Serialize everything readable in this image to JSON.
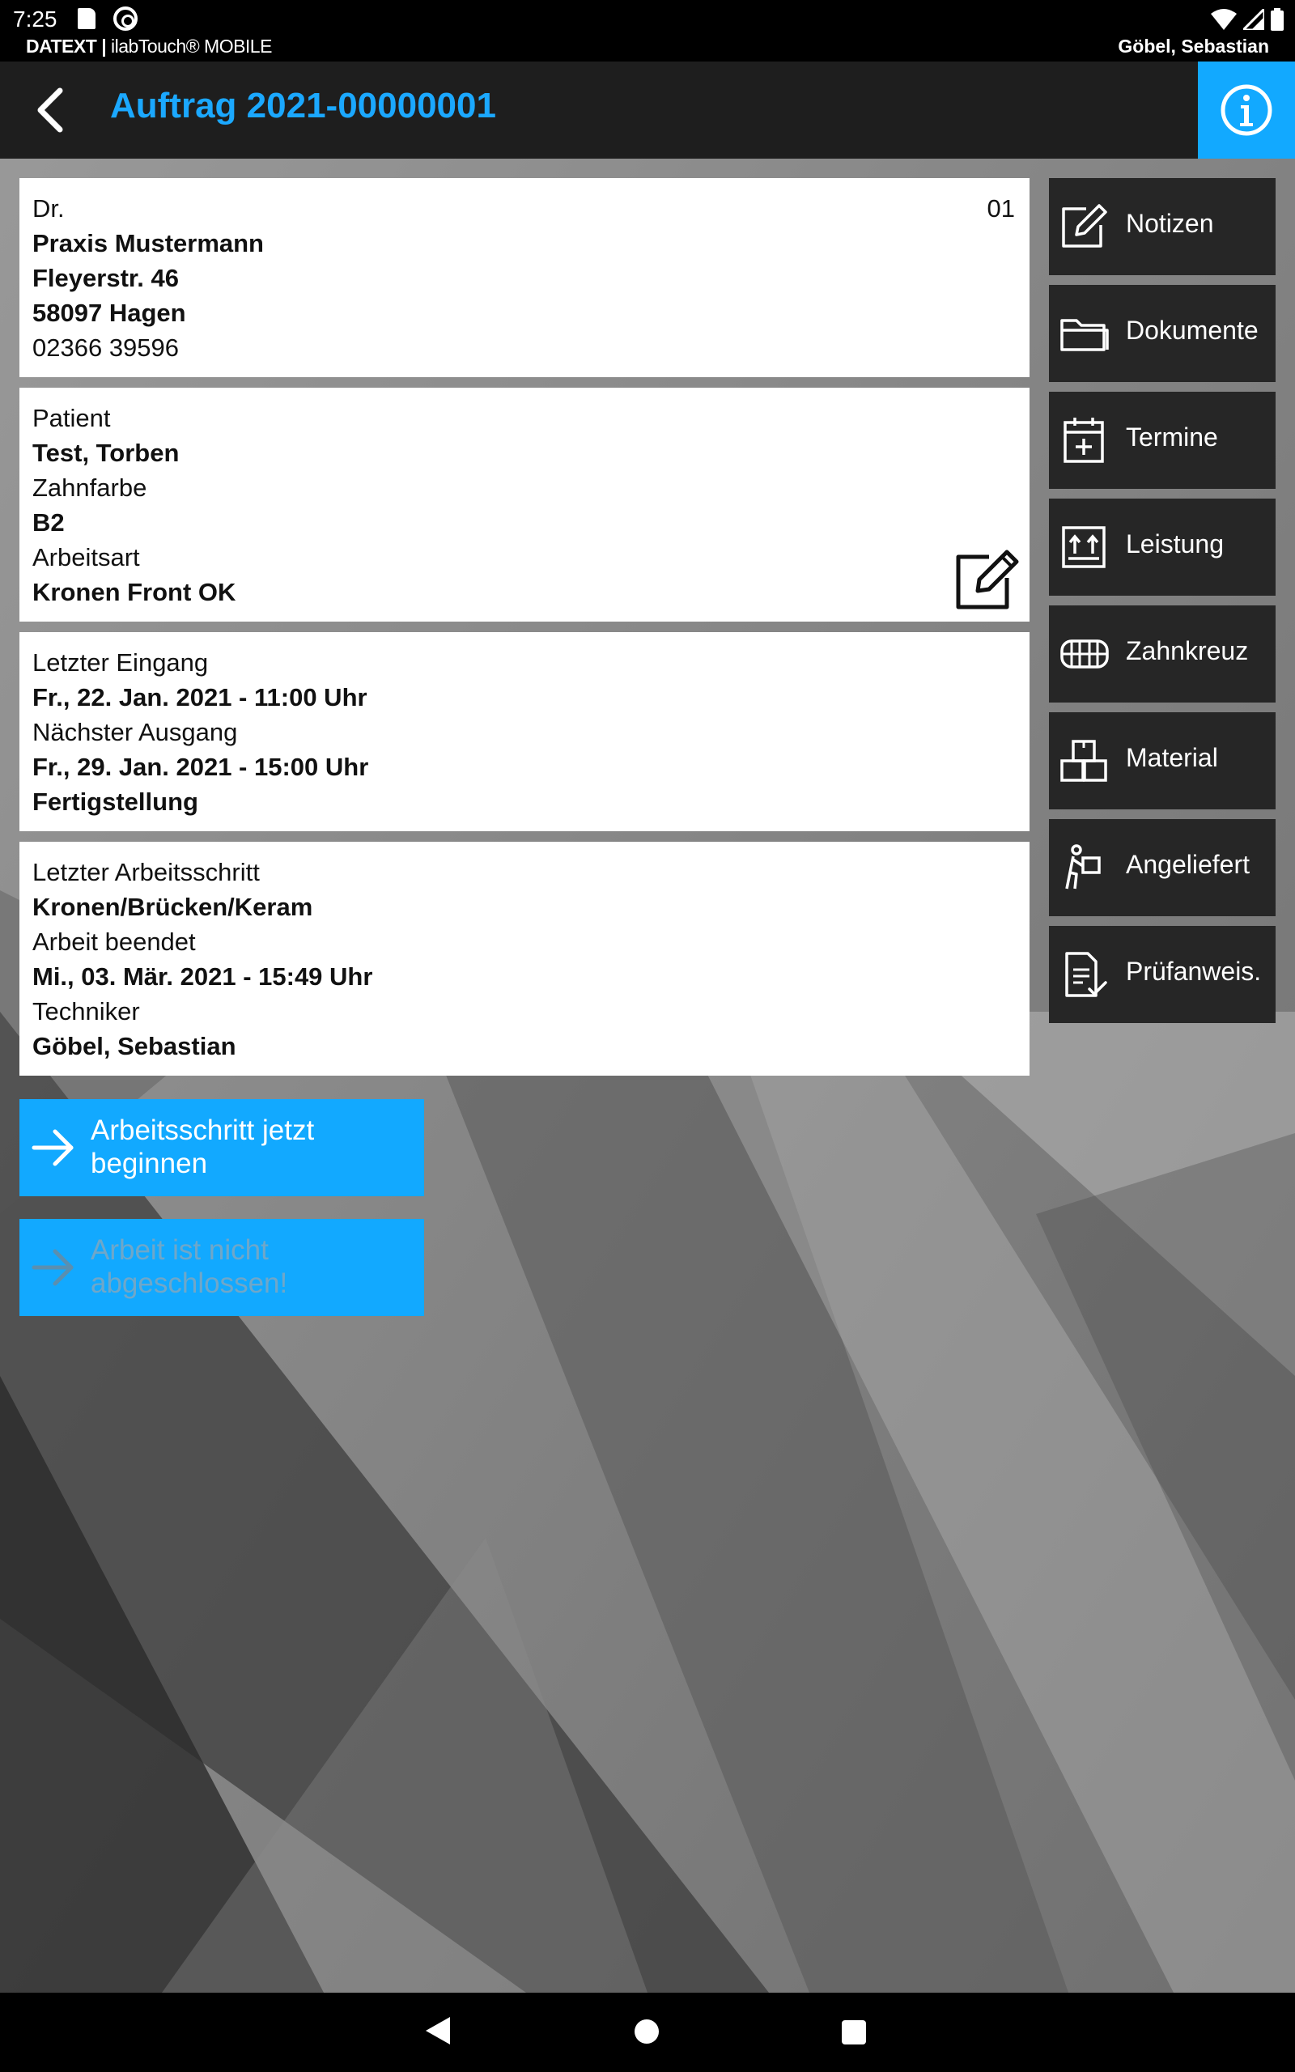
{
  "status_bar": {
    "time": "7:25",
    "brand": "DATEXT",
    "brand_sep": "|",
    "product": "ilabTouch® MOBILE",
    "user": "Göbel, Sebastian"
  },
  "app_bar": {
    "title": "Auftrag 2021-00000001"
  },
  "customer_card": {
    "title_prefix": "Dr.",
    "number": "01",
    "name": "Praxis Mustermann",
    "street": "Fleyerstr. 46",
    "city": "58097 Hagen",
    "phone": "02366 39596"
  },
  "patient_card": {
    "patient_label": "Patient",
    "patient_value": "Test, Torben",
    "shade_label": "Zahnfarbe",
    "shade_value": "B2",
    "worktype_label": "Arbeitsart",
    "worktype_value": "Kronen Front OK"
  },
  "dates_card": {
    "last_in_label": "Letzter Eingang",
    "last_in_value": "Fr., 22. Jan. 2021 - 11:00 Uhr",
    "next_out_label": "Nächster Ausgang",
    "next_out_value": "Fr., 29. Jan. 2021 - 15:00 Uhr",
    "completion_value": "Fertigstellung"
  },
  "step_card": {
    "last_step_label": "Letzter Arbeitsschritt",
    "last_step_value": "Kronen/Brücken/Keram",
    "finished_label": "Arbeit beendet",
    "finished_value": "Mi., 03. Mär. 2021 - 15:49 Uhr",
    "technician_label": "Techniker",
    "technician_value": "Göbel, Sebastian"
  },
  "actions": {
    "start_step": "Arbeitsschritt jetzt beginnen",
    "not_finished": "Arbeit ist nicht abgeschlossen!"
  },
  "side_menu": {
    "items": [
      {
        "label": "Notizen",
        "icon": "edit-icon"
      },
      {
        "label": "Dokumente",
        "icon": "folder-icon"
      },
      {
        "label": "Termine",
        "icon": "calendar-add-icon"
      },
      {
        "label": "Leistung",
        "icon": "upload-icon"
      },
      {
        "label": "Zahnkreuz",
        "icon": "teeth-icon"
      },
      {
        "label": "Material",
        "icon": "boxes-icon"
      },
      {
        "label": "Angeliefert",
        "icon": "delivery-icon"
      },
      {
        "label": "Prüfanweis.",
        "icon": "checklist-icon"
      }
    ]
  },
  "colors": {
    "accent": "#12a9ff",
    "title": "#1ba8ff",
    "menu_bg": "#262626",
    "app_bar_bg": "#1e1e1e"
  }
}
